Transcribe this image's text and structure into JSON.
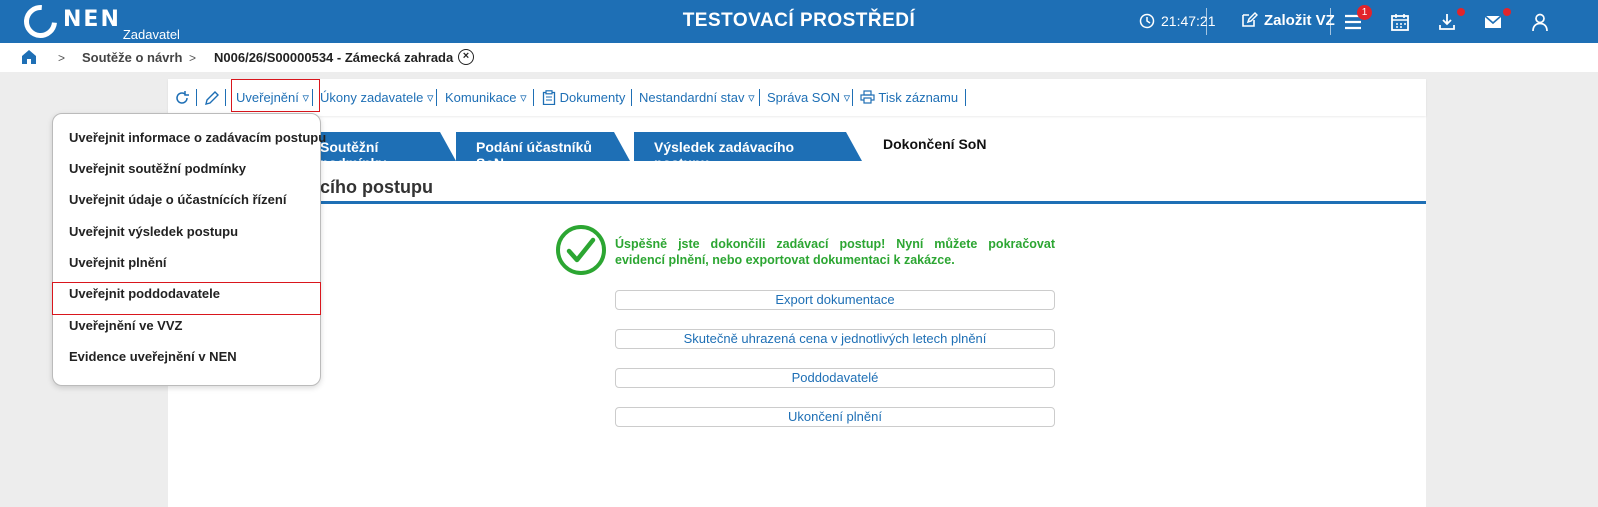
{
  "header": {
    "logo_text": "NEN",
    "logo_sub": "Zadavatel",
    "title": "TESTOVACÍ PROSTŘEDÍ",
    "time": "21:47:21",
    "create_label": "Založit VZ",
    "menu_badge": "1",
    "colors": {
      "brand": "#1e6fb5",
      "alert": "#e2242b"
    }
  },
  "breadcrumb": {
    "item1": "Soutěže o návrh",
    "item2": "N006/26/S00000534 - Zámecká zahrada"
  },
  "toolbar": {
    "publish": "Uveřejnění",
    "actions": "Úkony zadavatele",
    "communication": "Komunikace",
    "documents": "Dokumenty",
    "nonstandard": "Nestandardní stav",
    "admin": "Správa SON",
    "print": "Tisk záznamu"
  },
  "tabs": [
    "Soutěžní podmínky",
    "Podání účastníků SoN",
    "Výsledek zadávacího postupu",
    "Dokončení SoN"
  ],
  "section_title": "acího postupu",
  "success_message": "Úspěšně jste dokončili zadávací postup! Nyní můžete pokračovat evidencí plnění, nebo exportovat dokumentaci k zakázce.",
  "buttons": {
    "export": "Export dokumentace",
    "price": "Skutečně uhrazená cena v jednotlivých letech plnění",
    "subcontractors": "Poddodavatelé",
    "end": "Ukončení plnění"
  },
  "menu": [
    "Uveřejnit informace o zadávacím postupu",
    "Uveřejnit soutěžní podmínky",
    "Uveřejnit údaje o účastnících řízení",
    "Uveřejnit výsledek postupu",
    "Uveřejnit plnění",
    "Uveřejnit poddodavatele",
    "Uveřejnění ve VVZ",
    "Evidence uveřejnění v NEN"
  ],
  "menu_highlighted": "Uveřejnit poddodavatele",
  "success_color": "#2ca632"
}
